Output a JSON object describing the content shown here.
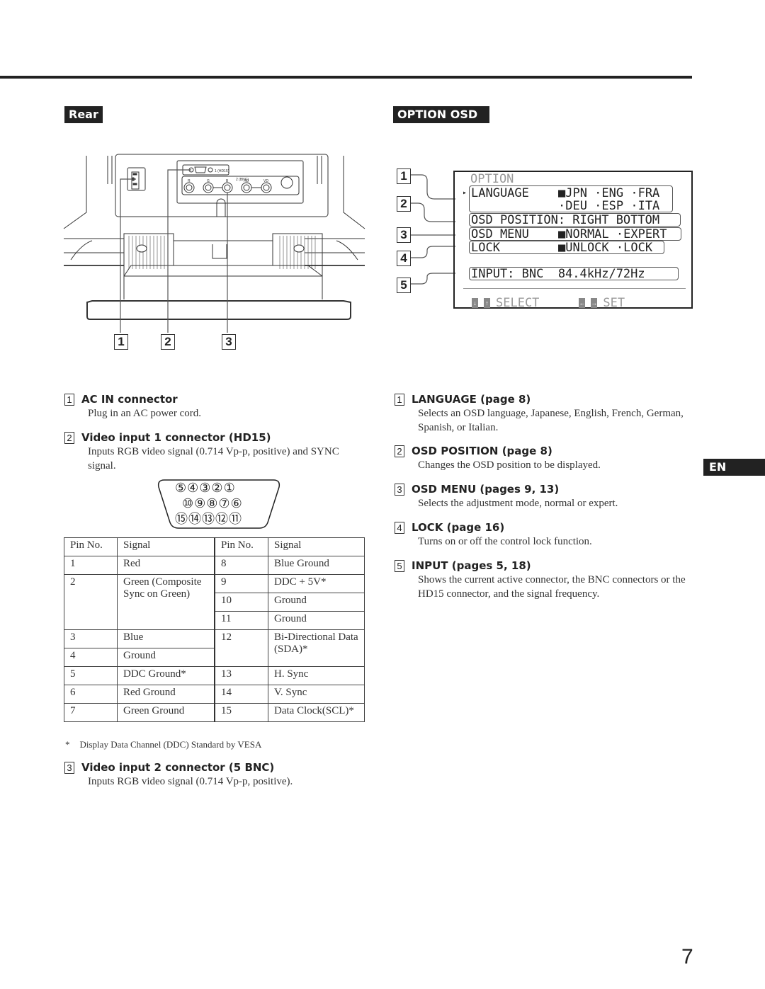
{
  "sections": {
    "rear_label": "Rear",
    "option_osd_label": "OPTION OSD",
    "language_tab": "EN"
  },
  "rear_diagram": {
    "callouts": [
      "1",
      "2",
      "3"
    ],
    "connector_labels": {
      "hd15": "1 (HD15)",
      "bnc": "2 (BNC)",
      "bnc_pins": [
        "R",
        "G",
        "B",
        "HD",
        "VD"
      ]
    }
  },
  "osd": {
    "title": "OPTION",
    "callouts": [
      "1",
      "2",
      "3",
      "4",
      "5"
    ],
    "language_label": "LANGUAGE",
    "language_options_row1": "■JPN ·ENG ·FRA",
    "language_options_row2": "·DEU ·ESP ·ITA",
    "osd_position": "OSD POSITION: RIGHT BOTTOM",
    "osd_menu_label": "OSD MENU",
    "osd_menu_options": "■NORMAL ·EXPERT",
    "lock_label": "LOCK",
    "lock_options": "■UNLOCK ·LOCK",
    "input": "INPUT: BNC  84.4kHz/72Hz",
    "footer_select": "SELECT",
    "footer_set": "SET",
    "keys": {
      "down": "↓",
      "up": "↑",
      "left": "←",
      "right": "→"
    }
  },
  "rear_items": [
    {
      "num": "1",
      "title": "AC IN connector",
      "body": "Plug in an AC power cord."
    },
    {
      "num": "2",
      "title": "Video input 1 connector (HD15)",
      "body": "Inputs RGB video signal (0.714 Vp-p, positive) and SYNC signal."
    },
    {
      "num": "3",
      "title": "Video input 2 connector (5 BNC)",
      "body": "Inputs RGB video signal (0.714 Vp-p, positive)."
    }
  ],
  "hd15_pinout_diagram": {
    "row1": [
      "⑤",
      "④",
      "③",
      "②",
      "①"
    ],
    "row2": [
      "⑩",
      "⑨",
      "⑧",
      "⑦",
      "⑥"
    ],
    "row3": [
      "⑮",
      "⑭",
      "⑬",
      "⑫",
      "⑪"
    ]
  },
  "pin_table": {
    "headers": [
      "Pin No.",
      "Signal",
      "Pin No.",
      "Signal"
    ],
    "left": [
      {
        "pin": "1",
        "signal": "Red"
      },
      {
        "pin": "2",
        "signal": "Green (Composite Sync on Green)"
      },
      {
        "pin": "3",
        "signal": "Blue"
      },
      {
        "pin": "4",
        "signal": "Ground"
      },
      {
        "pin": "5",
        "signal": "DDC Ground*"
      },
      {
        "pin": "6",
        "signal": "Red Ground"
      },
      {
        "pin": "7",
        "signal": "Green Ground"
      }
    ],
    "right": [
      {
        "pin": "8",
        "signal": "Blue Ground"
      },
      {
        "pin": "9",
        "signal": "DDC + 5V*"
      },
      {
        "pin": "10",
        "signal": "Ground"
      },
      {
        "pin": "11",
        "signal": "Ground"
      },
      {
        "pin": "12",
        "signal": "Bi-Directional Data (SDA)*"
      },
      {
        "pin": "13",
        "signal": "H. Sync"
      },
      {
        "pin": "14",
        "signal": "V. Sync"
      },
      {
        "pin": "15",
        "signal": "Data Clock(SCL)*"
      }
    ]
  },
  "footnote": {
    "mark": "*",
    "text": "Display Data Channel (DDC) Standard by VESA"
  },
  "osd_items": [
    {
      "num": "1",
      "title": "LANGUAGE (page 8)",
      "body": "Selects an OSD language, Japanese, English, French, German, Spanish, or Italian."
    },
    {
      "num": "2",
      "title": "OSD POSITION (page 8)",
      "body": "Changes the OSD position to be displayed."
    },
    {
      "num": "3",
      "title": "OSD MENU (pages 9, 13)",
      "body": "Selects the adjustment mode, normal or expert."
    },
    {
      "num": "4",
      "title": "LOCK (page 16)",
      "body": "Turns on or off the control lock function."
    },
    {
      "num": "5",
      "title": "INPUT (pages 5, 18)",
      "body": "Shows the current active connector, the BNC connectors or the HD15 connector, and the signal frequency."
    }
  ],
  "page_number": "7"
}
